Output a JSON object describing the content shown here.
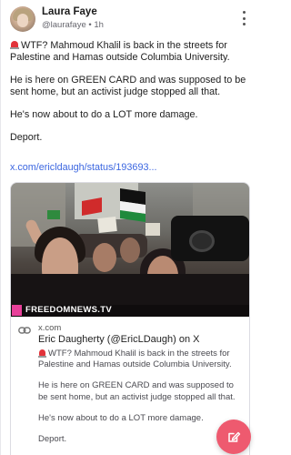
{
  "post": {
    "author_name": "Laura Faye",
    "handle": "@laurafaye",
    "separator": "•",
    "time": "1h",
    "paragraphs": [
      "WTF? Mahmoud Khalil is back in the streets for Palestine and Hamas outside Columbia University.",
      "He is here on GREEN CARD and was supposed to be sent home, but an activist judge stopped all that.",
      "He's now about to do a LOT more damage.",
      "Deport."
    ],
    "lead_icon": "alarm-siren-icon",
    "link_text": "x.com/ericldaugh/status/193693..."
  },
  "card": {
    "watermark": "FREEDOMNEWS.TV",
    "domain": "x.com",
    "title": "Eric Daugherty (@EricLDaugh) on X",
    "desc_paragraphs": [
      "WTF? Mahmoud Khalil is back in the streets for Palestine and Hamas outside Columbia University.",
      "He is here on GREEN CARD and was supposed to be sent home, but an activist judge stopped all that.",
      "He's now about to do a LOT more damage.",
      "Deport."
    ]
  },
  "colors": {
    "link": "#3b66e0",
    "fab": "#ee5a6f",
    "watermark_accent": "#e8409a"
  },
  "icons": {
    "more": "more-vertical-icon",
    "link": "link-icon",
    "compose": "compose-edit-icon"
  }
}
